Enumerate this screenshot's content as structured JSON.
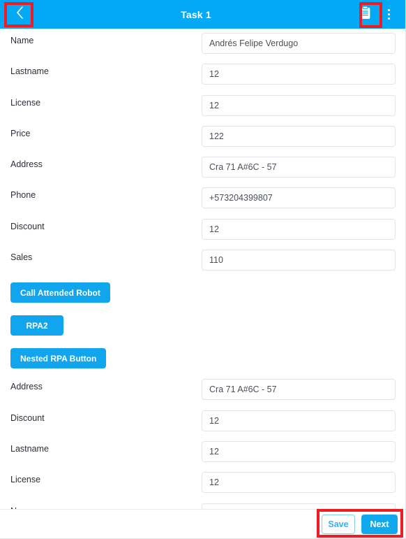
{
  "header": {
    "title": "Task 1",
    "back_icon": "chevron-left-icon",
    "clipboard_icon": "clipboard-icon",
    "overflow_icon": "more-vertical-icon"
  },
  "form_top": [
    {
      "label": "Name",
      "value": "Andrés Felipe Verdugo"
    },
    {
      "label": "Lastname",
      "value": "12"
    },
    {
      "label": "License",
      "value": "12"
    },
    {
      "label": "Price",
      "value": "122"
    },
    {
      "label": "Address",
      "value": "Cra 71 A#6C - 57"
    },
    {
      "label": "Phone",
      "value": "+573204399807"
    },
    {
      "label": "Discount",
      "value": "12"
    },
    {
      "label": "Sales",
      "value": "110"
    }
  ],
  "action_buttons": [
    {
      "label": "Call Attended Robot"
    },
    {
      "label": "RPA2"
    },
    {
      "label": "Nested RPA Button"
    }
  ],
  "form_bottom": [
    {
      "label": "Address",
      "value": "Cra 71 A#6C - 57"
    },
    {
      "label": "Discount",
      "value": "12"
    },
    {
      "label": "Lastname",
      "value": "12"
    },
    {
      "label": "License",
      "value": "12"
    },
    {
      "label": "Name",
      "value": ""
    }
  ],
  "footer": {
    "save_label": "Save",
    "next_label": "Next"
  },
  "colors": {
    "appbar_blue": "#03a9f4",
    "button_blue": "#10a5ec",
    "highlight_red": "#ee1c25",
    "save_border": "#7fd0f5"
  }
}
